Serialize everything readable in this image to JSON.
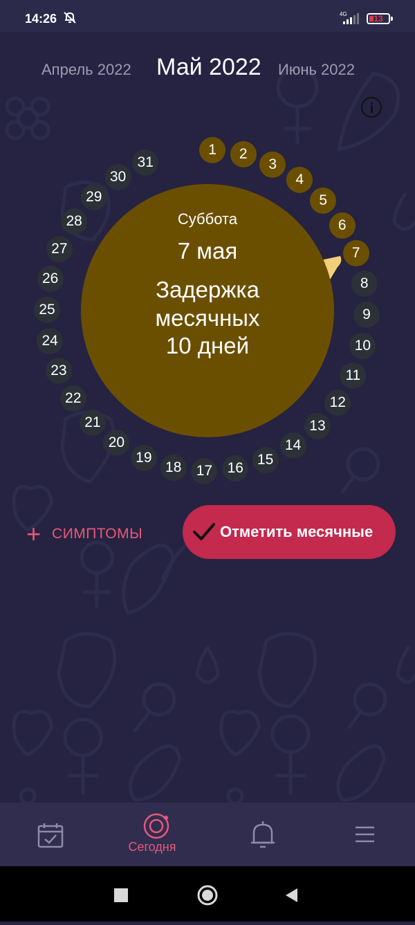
{
  "status_bar": {
    "time": "14:26",
    "network": "4G",
    "battery": "13",
    "icons": [
      "bell-off-icon",
      "signal-icon",
      "battery-low-icon"
    ]
  },
  "months": {
    "prev": "Апрель 2022",
    "current": "Май 2022",
    "next": "Июнь 2022"
  },
  "info_icon": "info-icon",
  "cycle_ring": {
    "days": [
      "1",
      "2",
      "3",
      "4",
      "5",
      "6",
      "7",
      "8",
      "9",
      "10",
      "11",
      "12",
      "13",
      "14",
      "15",
      "16",
      "17",
      "18",
      "19",
      "20",
      "21",
      "22",
      "23",
      "24",
      "25",
      "26",
      "27",
      "28",
      "29",
      "30",
      "31"
    ],
    "period_days": [
      "1",
      "2",
      "3",
      "4",
      "5",
      "6",
      "7"
    ],
    "selected_day": "7",
    "colors": {
      "period": "#6b4f00",
      "regular": "#2b3136",
      "pointer": "#f4cf7a"
    }
  },
  "selected_day": {
    "weekday": "Суббота",
    "date": "7 мая",
    "status_line1": "Задержка",
    "status_line2": "месячных",
    "status_line3": "10 дней"
  },
  "actions": {
    "symptoms_label": "СИМПТОМЫ",
    "mark_period_label": "Отметить месячные"
  },
  "bottom_nav": {
    "items": [
      {
        "icon": "calendar-check-icon",
        "label": ""
      },
      {
        "icon": "target-icon",
        "label": "Сегодня",
        "active": true
      },
      {
        "icon": "bell-icon",
        "label": ""
      },
      {
        "icon": "menu-icon",
        "label": ""
      }
    ]
  },
  "theme": {
    "background": "#252341",
    "accent": "#e8587a",
    "button": "#c4294e",
    "disc": "#6b4f00"
  }
}
